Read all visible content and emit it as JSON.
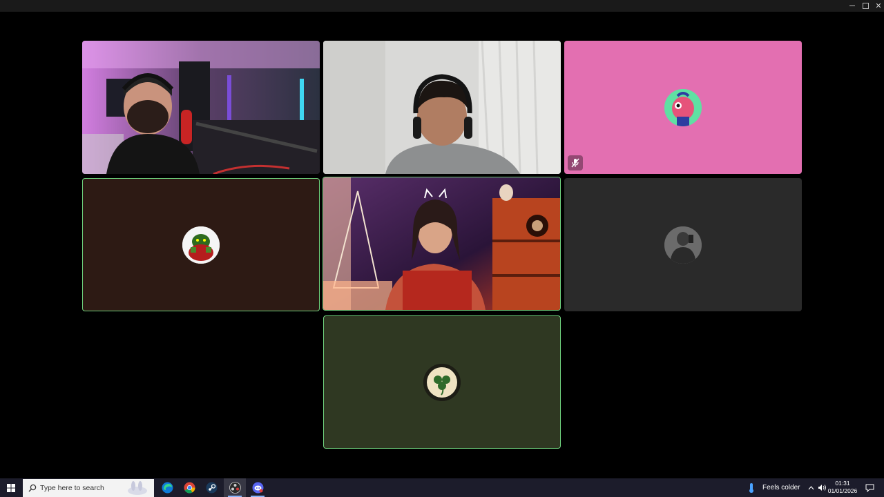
{
  "window": {
    "minimize_icon": "minimize-icon",
    "maximize_icon": "maximize-icon",
    "close_icon": "close-icon"
  },
  "participants": [
    {
      "id": "p1",
      "type": "video",
      "description_icon": "webcam-video"
    },
    {
      "id": "p2",
      "type": "video",
      "description_icon": "webcam-video"
    },
    {
      "id": "p3",
      "type": "avatar",
      "background": "#e36fb1",
      "muted": true,
      "mute_icon": "muted-microphone-icon"
    },
    {
      "id": "p4",
      "type": "avatar",
      "background": "#2d1a14",
      "speaking": true
    },
    {
      "id": "p5",
      "type": "video",
      "speaking": true
    },
    {
      "id": "p6",
      "type": "avatar",
      "background": "#2a2a2a"
    },
    {
      "id": "p7",
      "type": "avatar",
      "background": "#2f3822",
      "speaking": true
    }
  ],
  "taskbar": {
    "search_placeholder": "Type here to search",
    "apps": [
      "edge-icon",
      "chrome-icon",
      "steam-icon",
      "obs-icon",
      "discord-icon"
    ],
    "weather_text": "Feels colder",
    "time": "01:31",
    "date": "01/01/2026"
  },
  "colors": {
    "speaking_border": "#6fd27d",
    "taskbar": "#1c1c2b"
  }
}
